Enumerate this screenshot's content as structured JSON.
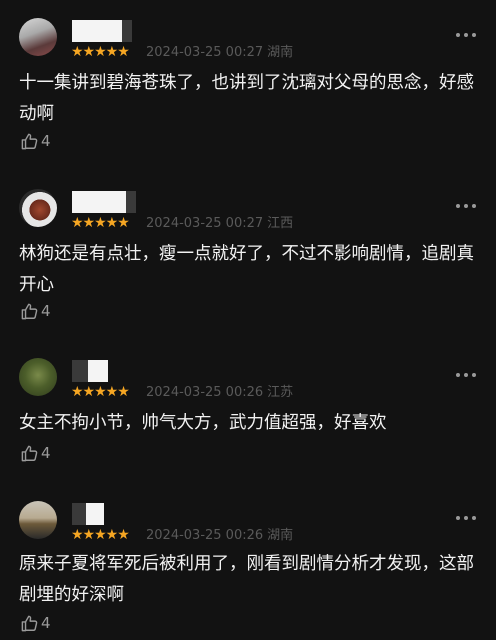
{
  "comments": [
    {
      "stars": "★★★★★",
      "date": "2024-03-25 00:27",
      "location": "湖南",
      "text": "十一集讲到碧海苍珠了，也讲到了沈璃对父母的思念，好感动啊",
      "likes": "4"
    },
    {
      "stars": "★★★★★",
      "date": "2024-03-25 00:27",
      "location": "江西",
      "text": "林狗还是有点壮，瘦一点就好了，不过不影响剧情，追剧真开心",
      "likes": "4"
    },
    {
      "stars": "★★★★★",
      "date": "2024-03-25 00:26",
      "location": "江苏",
      "text": "女主不拘小节，帅气大方，武力值超强，好喜欢",
      "likes": "4"
    },
    {
      "stars": "★★★★★",
      "date": "2024-03-25 00:26",
      "location": "湖南",
      "text": "原来子夏将军死后被利用了，刚看到剧情分析才发现，这部剧埋的好深啊",
      "likes": "4"
    }
  ],
  "icons": {
    "more": "more-dots-icon",
    "like": "thumbs-up-icon"
  },
  "colors": {
    "background": "#121212",
    "stars": "#f5a623",
    "meta": "#5a5a5a"
  }
}
